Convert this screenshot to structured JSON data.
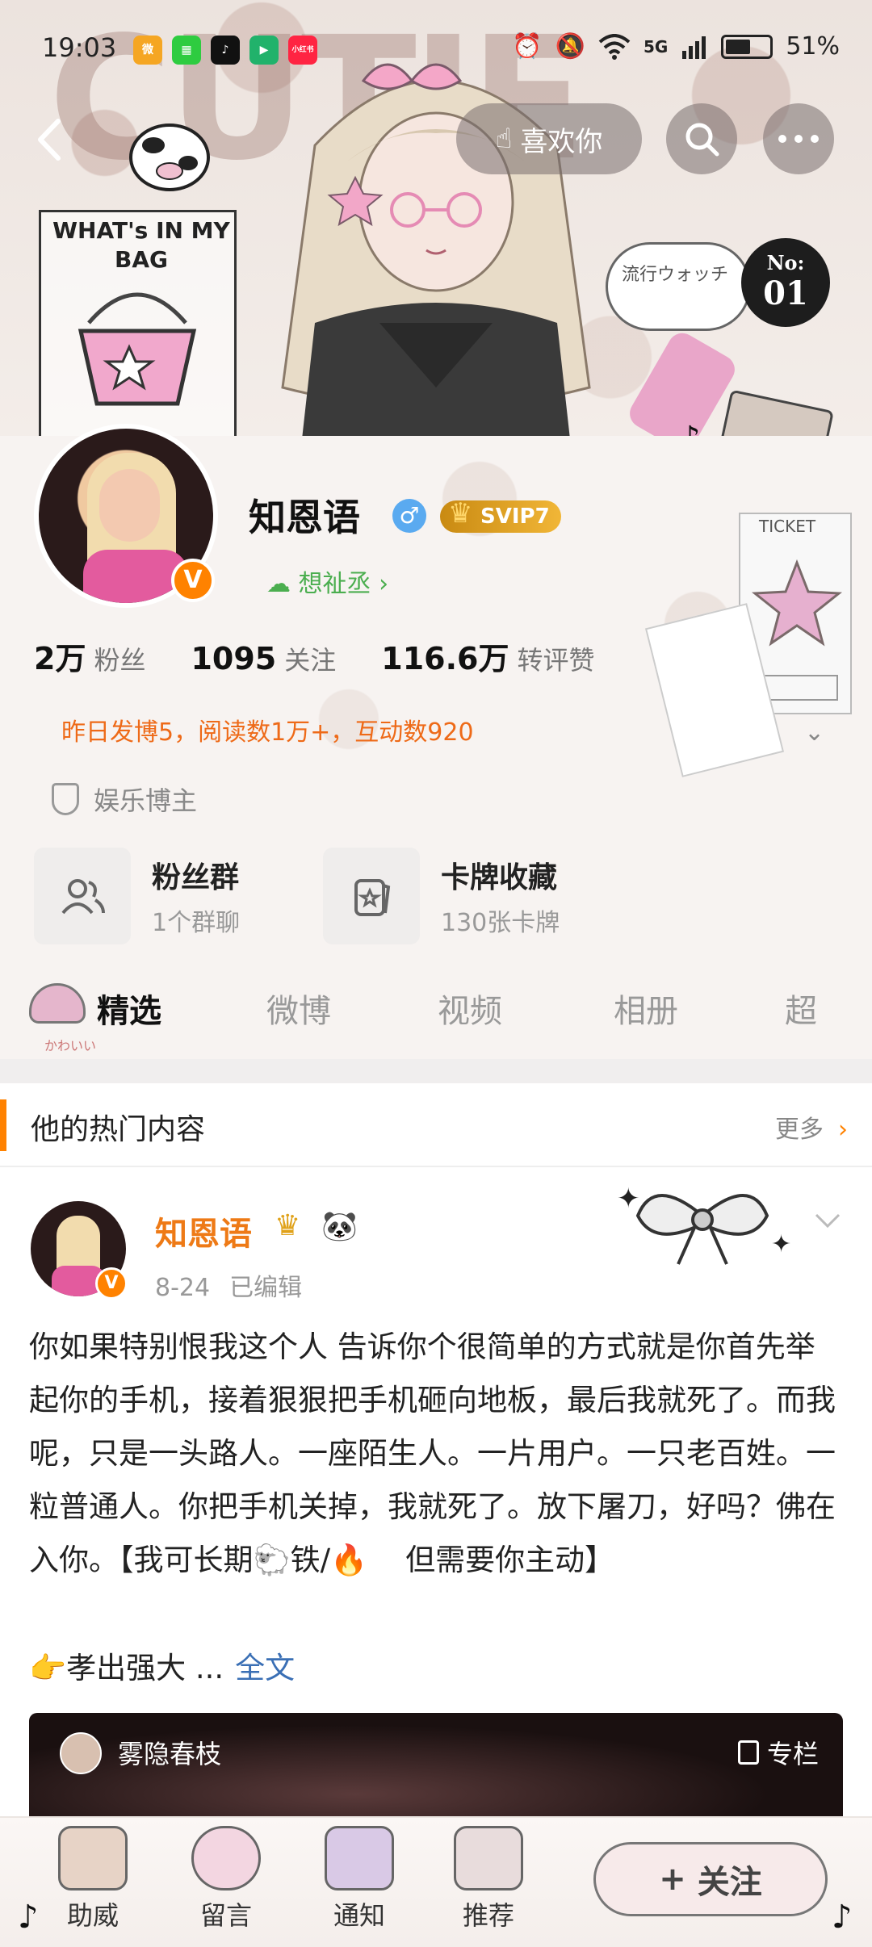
{
  "status_bar": {
    "time": "19:03",
    "apps": [
      {
        "name": "weibo-app-icon",
        "label": "微",
        "color": "#f5a623"
      },
      {
        "name": "green-app-icon",
        "label": "▦",
        "color": "#2ecc40"
      },
      {
        "name": "tiktok-app-icon",
        "label": "♪",
        "color": "#111111"
      },
      {
        "name": "video-app-icon",
        "label": "▶",
        "color": "#21b26b"
      },
      {
        "name": "xiaohongshu-app-icon",
        "label": "小红书",
        "color": "#ff2442"
      }
    ],
    "network": "5G",
    "battery": "51%"
  },
  "nav": {
    "like_label": "喜欢你"
  },
  "banner": {
    "bag_title": "WHAT's IN MY BAG",
    "bubble_text": "流行ウォッチ",
    "badge_top": "No:",
    "badge_num": "01"
  },
  "profile": {
    "name": "知恩语",
    "vip": "SVIP7",
    "wish_label": "想祉丞",
    "stats": [
      {
        "value": "2万",
        "label": "粉丝"
      },
      {
        "value": "1095",
        "label": "关注"
      },
      {
        "value": "116.6万",
        "label": "转评赞"
      }
    ],
    "activity": "昨日发博5，阅读数1万+，互动数920",
    "category": "娱乐博主",
    "ticket": "TICKET"
  },
  "features": [
    {
      "title": "粉丝群",
      "subtitle": "1个群聊"
    },
    {
      "title": "卡牌收藏",
      "subtitle": "130张卡牌"
    }
  ],
  "tabs": {
    "active": "精选",
    "active_sub": "かわいい",
    "items": [
      "微博",
      "视频",
      "相册",
      "超"
    ]
  },
  "hot": {
    "title": "他的热门内容",
    "more": "更多"
  },
  "post": {
    "author": "知恩语",
    "date": "8-24",
    "edited": "已编辑",
    "text": "你如果特别恨我这个人 告诉你个很简单的方式就是你首先举起你的手机，接着狠狠把手机砸向地板，最后我就死了。而我呢，只是一头路人。一座陌生人。一片用户。一只老百姓。一粒普通人。你把手机关掉，我就死了。放下屠刀，好吗？佛在入你。【我可长期🐑铁/🔥    但需要你主动】",
    "more_prefix": "👉孝出强大 ...",
    "full_text": "全文",
    "column_author": "雾隐春枝",
    "column_tag": "专栏"
  },
  "bottom_bar": {
    "items": [
      "助威",
      "留言",
      "通知",
      "推荐"
    ],
    "follow": "关注"
  }
}
